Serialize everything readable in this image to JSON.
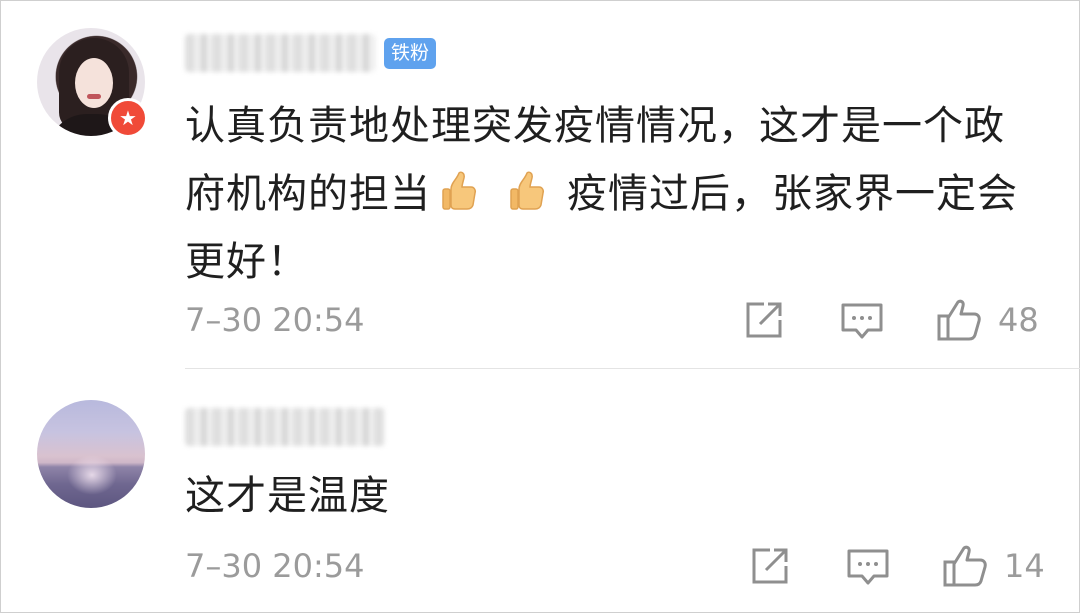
{
  "comments": [
    {
      "user_badge": "铁粉",
      "vip_icon": "star-icon",
      "text_before": "认真负责地处理突发疫情情况，这才是一个政府机构的担当",
      "emoji": "thumbs-up-emoji",
      "text_after": "疫情过后，张家界一定会更好！",
      "timestamp": "7–30 20:54",
      "likes": "48"
    },
    {
      "text": "这才是温度",
      "timestamp": "7–30 20:54",
      "likes": "14"
    }
  ],
  "icons": {
    "share": "share-icon",
    "reply": "comment-icon",
    "like": "thumbs-up-icon"
  },
  "colors": {
    "fan_badge": "#5fa2ee",
    "vip_badge": "#f04a38",
    "meta_text": "#9b9b9b",
    "body_text": "#1f1f1f"
  }
}
